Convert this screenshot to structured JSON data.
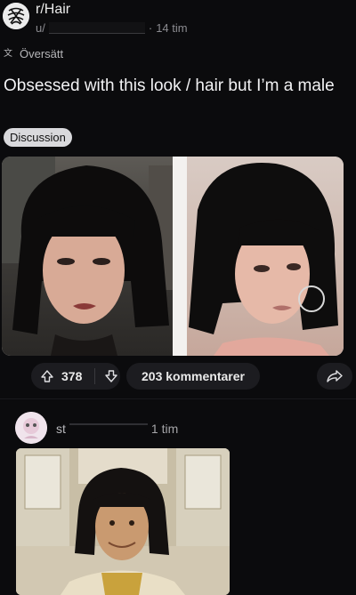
{
  "header": {
    "subreddit": "r/Hair",
    "username": "u/",
    "time_sep": "·",
    "time": "14 tim"
  },
  "translate": {
    "label": "Översätt"
  },
  "post": {
    "title": "Obsessed with this look / hair but I’m a male",
    "flair": "Discussion"
  },
  "actions": {
    "votes": "378",
    "comments": "203 kommentarer"
  },
  "comment": {
    "username": "st",
    "time": "1 tim"
  },
  "colors": {
    "background": "#0b0b0d",
    "pill": "#1c1c20",
    "flair_bg": "#d9d9dc"
  },
  "icons": [
    "subreddit-avatar-icon",
    "translate-icon",
    "upvote-icon",
    "downvote-icon",
    "share-icon",
    "user-avatar-icon"
  ]
}
